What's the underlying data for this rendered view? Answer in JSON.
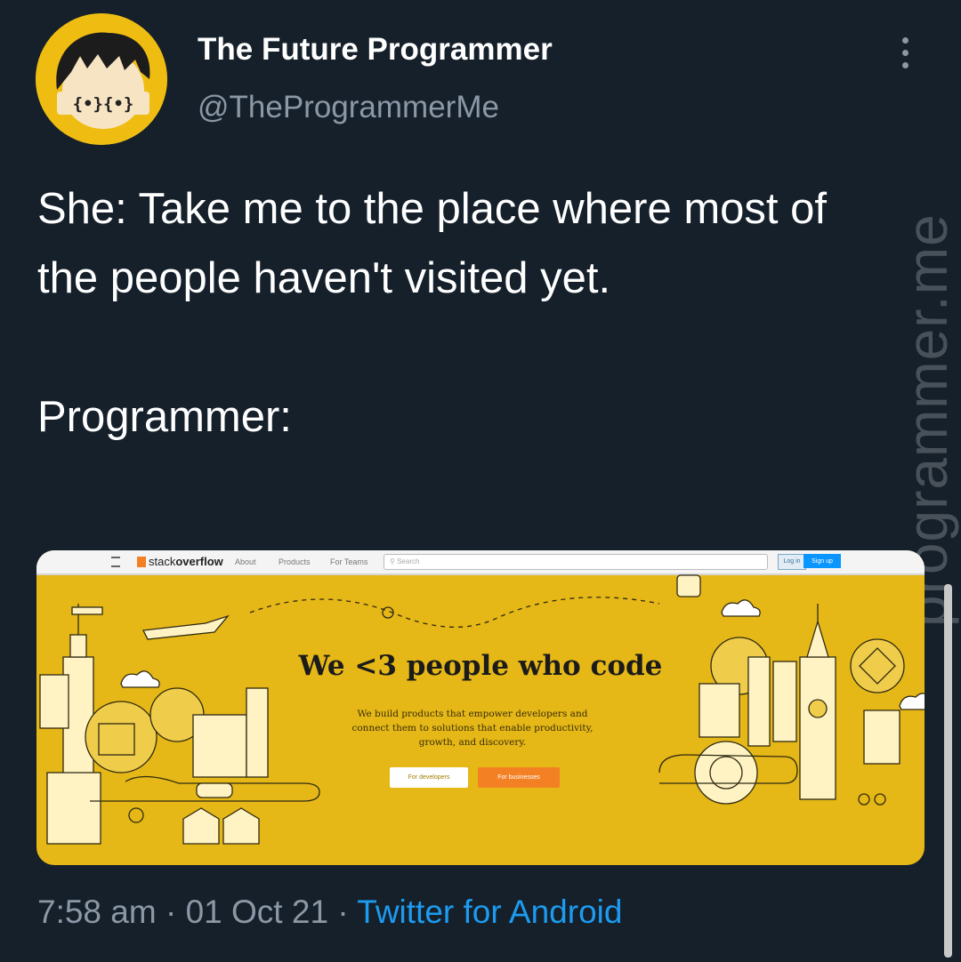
{
  "author": {
    "name": "The Future Programmer",
    "handle": "@TheProgrammerMe",
    "avatar_text": "{•}{•}"
  },
  "tweet": {
    "line1": "She: Take me to the place where most of the people haven't visited yet.",
    "line2": "Programmer:"
  },
  "watermark": "programmer.me",
  "media": {
    "logo_prefix": "stack",
    "logo_bold": "overflow",
    "nav_links": [
      "About",
      "Products",
      "For Teams"
    ],
    "search_placeholder": "Search",
    "login_label": "Log in",
    "signup_label": "Sign up",
    "hero_title": "We <3 people who code",
    "hero_subtitle": "We build products that empower developers and connect them to solutions that enable productivity, growth, and discovery.",
    "btn_developers": "For developers",
    "btn_businesses": "For businesses"
  },
  "meta": {
    "time": "7:58 am",
    "separator": "·",
    "date": "01 Oct 21",
    "source": "Twitter for Android"
  },
  "colors": {
    "background": "#15202b",
    "accent": "#1d9bf0",
    "avatar_bg": "#efbd12",
    "media_bg": "#e5b717",
    "stackoverflow_orange": "#f48024"
  },
  "icons": [
    "more-options-icon",
    "hamburger-icon",
    "search-icon"
  ]
}
